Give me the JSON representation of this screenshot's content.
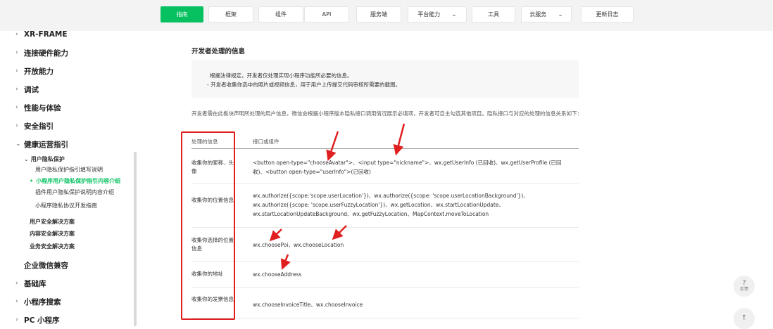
{
  "nav": {
    "items": [
      "指南",
      "框架",
      "组件",
      "API",
      "服务端",
      "平台能力",
      "工具",
      "云服务",
      "更新日志"
    ],
    "active_index": 0,
    "accent": "#07c160"
  },
  "sidebar": {
    "top_items": [
      {
        "label": "XR-FRAME"
      },
      {
        "label": "连接硬件能力"
      },
      {
        "label": "开放能力"
      },
      {
        "label": "调试"
      },
      {
        "label": "性能与体验"
      },
      {
        "label": "安全指引"
      },
      {
        "label": "健康运营指引"
      }
    ],
    "privacy_group": "用户隐私保护",
    "privacy_items": [
      "用户隐私保护指引填写说明",
      "小程序用户隐私保护指引内容介绍",
      "插件用户隐私保护说明内容介绍",
      "小程序隐私协议开发指南"
    ],
    "active_privacy_index": 1,
    "solutions": [
      "用户安全解决方案",
      "内容安全解决方案",
      "业务安全解决方案"
    ],
    "bottom_items": [
      {
        "label": "企业微信兼容"
      },
      {
        "label": "基础库"
      },
      {
        "label": "小程序搜索"
      },
      {
        "label": "PC 小程序"
      }
    ]
  },
  "content": {
    "section_title": "开发者处理的信息",
    "notice_line1": "根据法律规定，开发者仅处理实现小程序功能所必要的信息。",
    "notice_line2": "-  开发者收集你选中的照片或视频信息，用于用户上传提交代码审核所需要的截图。",
    "intro": "开发者需在此板块声明所处理的用户信息，微信会根据小程序版本隐私接口调用情况展示必填项，开发者可自主勾选其他项目。隐私接口与对应的处理的信息关系如下：",
    "table_header": [
      "处理的信息",
      "接口或组件"
    ],
    "rows": [
      {
        "label": "收集你的昵称、头像",
        "api": "<button open-type=\"chooseAvatar\">、<input type=\"nickname\">、wx.getUserInfo (已回收)、wx.getUserProfile (已回收)、<button open-type=\"userInfo\">(已回收)"
      },
      {
        "label": "收集你的位置信息",
        "api": "wx.authorize({scope:'scope.userLocation'})、wx.authorize({scope: 'scope.userLocationBackground'})、wx.authorize({scope: 'scope.userFuzzyLocation'})、wx.getLocation、wx.startLocationUpdate、wx.startLocationUpdateBackground、wx.getFuzzyLocation、MapContext.moveToLocation"
      },
      {
        "label": "收集你选择的位置信息",
        "api": "wx.choosePoi、wx.chooseLocation"
      },
      {
        "label": "收集你的地址",
        "api": "wx.chooseAddress"
      },
      {
        "label": "收集你的发票信息",
        "api": "wx.chooseInvoiceTitle、wx.chooseInvoice"
      }
    ]
  },
  "float": {
    "feedback_q": "?",
    "feedback_label": "反馈",
    "top_arrow": "↑"
  },
  "annotation_color": "#e02020"
}
